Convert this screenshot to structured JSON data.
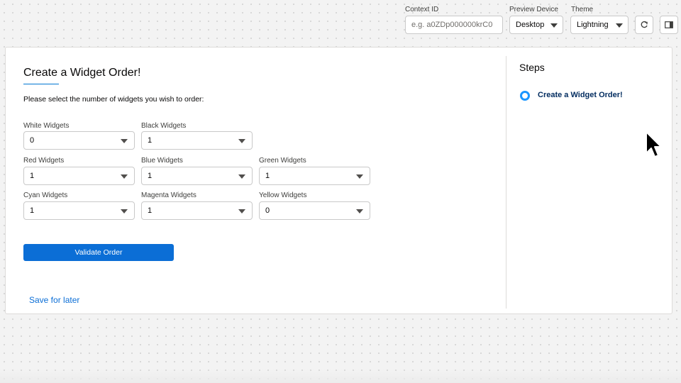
{
  "toolbar": {
    "context_label": "Context ID",
    "context_placeholder": "e.g. a0ZDp000000krC0",
    "device_label": "Preview Device",
    "device_value": "Desktop",
    "theme_label": "Theme",
    "theme_value": "Lightning"
  },
  "form": {
    "title": "Create a Widget Order!",
    "instruction": "Please select the number of widgets you wish to order:",
    "fields": {
      "white": {
        "label": "White Widgets",
        "value": "0"
      },
      "black": {
        "label": "Black Widgets",
        "value": "1"
      },
      "red": {
        "label": "Red Widgets",
        "value": "1"
      },
      "blue": {
        "label": "Blue Widgets",
        "value": "1"
      },
      "green": {
        "label": "Green Widgets",
        "value": "1"
      },
      "cyan": {
        "label": "Cyan Widgets",
        "value": "1"
      },
      "magenta": {
        "label": "Magenta Widgets",
        "value": "1"
      },
      "yellow": {
        "label": "Yellow Widgets",
        "value": "0"
      }
    },
    "validate_label": "Validate Order",
    "save_later_label": "Save for later"
  },
  "steps": {
    "title": "Steps",
    "items": [
      {
        "label": "Create a Widget Order!"
      }
    ]
  },
  "icons": {
    "refresh": "refresh-icon",
    "panel": "panel-toggle-icon",
    "cursor": "mouse-cursor-icon"
  },
  "colors": {
    "brand": "#0b6ed6",
    "step_active": "#1b96ff"
  }
}
